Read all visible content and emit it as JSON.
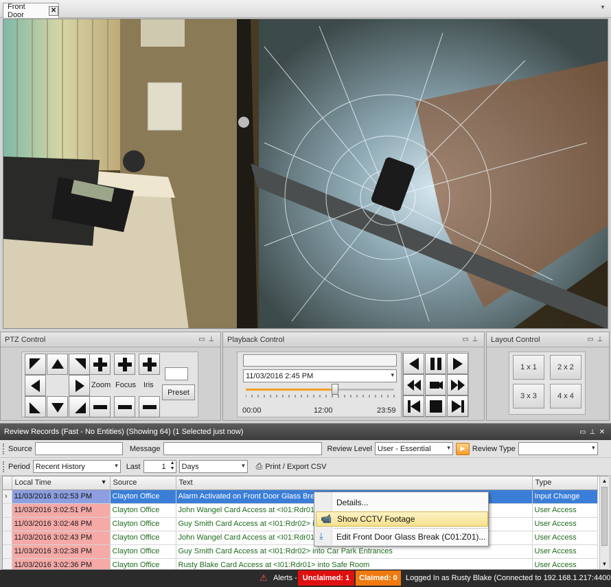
{
  "tab": {
    "label": "Front Door"
  },
  "ptz": {
    "title": "PTZ Control",
    "zoom": "Zoom",
    "focus": "Focus",
    "iris": "Iris",
    "preset": "Preset"
  },
  "playback": {
    "title": "Playback Control",
    "datetime": "11/03/2016 2:45 PM",
    "timeline_labels": [
      "00:00",
      "12:00",
      "23:59"
    ],
    "slider_position": 0.6
  },
  "layout": {
    "title": "Layout Control",
    "buttons": [
      "1 x 1",
      "2 x 2",
      "3 x 3",
      "4 x 4"
    ]
  },
  "review": {
    "title": "Review Records (Fast - No Entities) (Showing 64) (1 Selected just now)",
    "filters": {
      "source_label": "Source",
      "source_value": "",
      "message_label": "Message",
      "message_value": "",
      "review_level_label": "Review Level",
      "review_level_value": "User - Essential",
      "review_type_label": "Review Type",
      "review_type_value": "",
      "period_label": "Period",
      "period_value": "Recent History",
      "last_label": "Last",
      "last_value": "1",
      "unit_value": "Days",
      "export_label": "Print / Export CSV"
    },
    "columns": [
      "Local Time",
      "Source",
      "Text",
      "Type"
    ],
    "rows": [
      {
        "time": "11/03/2016 3:02:53 PM",
        "source": "Clayton Office",
        "text": "Alarm Activated on Front Door Glass Break",
        "type": "Input Change",
        "selected": true
      },
      {
        "time": "11/03/2016 3:02:51 PM",
        "source": "Clayton Office",
        "text": "John Wangel Card Access at <I01:Rdr01>",
        "type": "User Access"
      },
      {
        "time": "11/03/2016 3:02:48 PM",
        "source": "Clayton Office",
        "text": "Guy Smith Card Access at <I01:Rdr02> into",
        "type": "User Access"
      },
      {
        "time": "11/03/2016 3:02:43 PM",
        "source": "Clayton Office",
        "text": "John Wangel Card Access at <I01:Rdr01>",
        "type": "User Access"
      },
      {
        "time": "11/03/2016 3:02:38 PM",
        "source": "Clayton Office",
        "text": "Guy Smith Card Access at <I01:Rdr02> into Car Park Entrances",
        "type": "User Access"
      },
      {
        "time": "11/03/2016 3:02:36 PM",
        "source": "Clayton Office",
        "text": "Rusty Blake Card Access at <I01:Rdr01> into Safe Room",
        "type": "User Access"
      }
    ]
  },
  "context_menu": {
    "items": [
      "Details...",
      "Show CCTV Footage",
      "Edit Front Door Glass Break (C01:Z01)..."
    ]
  },
  "status": {
    "alerts": "Alerts -",
    "unclaimed": "Unclaimed: 1",
    "claimed": "Claimed: 0",
    "login": "Logged In as Rusty Blake (Connected to 192.168.1.217:44000)"
  },
  "colors": {
    "unclaimed": "#e01010",
    "claimed": "#f07a10",
    "selection": "#3a7ed8",
    "alarm_time": "#f5aaa8"
  }
}
